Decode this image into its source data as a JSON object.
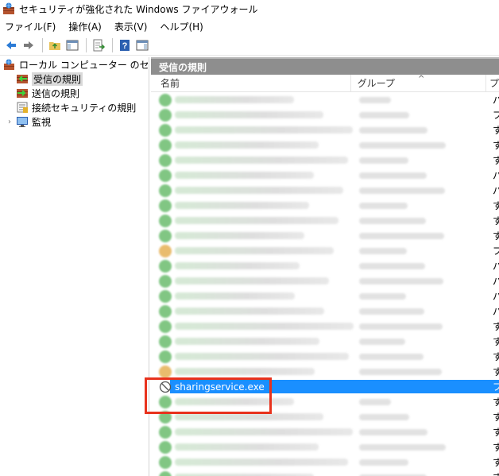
{
  "window": {
    "title": "セキュリティが強化された Windows ファイアウォール"
  },
  "menu": [
    {
      "label": "ファイル(F)"
    },
    {
      "label": "操作(A)"
    },
    {
      "label": "表示(V)"
    },
    {
      "label": "ヘルプ(H)"
    }
  ],
  "toolbar": {
    "icons": [
      "back-icon",
      "forward-icon",
      "folder-up-icon",
      "show-hide-tree-icon",
      "export-list-icon",
      "help-icon",
      "show-hide-action-pane-icon"
    ]
  },
  "tree": {
    "root": "ローカル コンピューター のセキュリティ",
    "items": [
      {
        "label": "受信の規則",
        "selected": true
      },
      {
        "label": "送信の規則"
      },
      {
        "label": "接続セキュリティの規則"
      },
      {
        "label": "監視"
      }
    ]
  },
  "pane": {
    "title": "受信の規則",
    "columns": {
      "name": "名前",
      "group": "グループ",
      "third": "プ"
    }
  },
  "rules": [
    {
      "col3": "パ",
      "status": "allow"
    },
    {
      "col3": "プ",
      "status": "allow"
    },
    {
      "col3": "す",
      "status": "allow"
    },
    {
      "col3": "す",
      "status": "allow"
    },
    {
      "col3": "す",
      "status": "allow"
    },
    {
      "col3": "パ",
      "status": "allow"
    },
    {
      "col3": "パ",
      "status": "allow"
    },
    {
      "col3": "す",
      "status": "allow"
    },
    {
      "col3": "す",
      "status": "allow"
    },
    {
      "col3": "す",
      "status": "allow"
    },
    {
      "col3": "プ",
      "status": "warn"
    },
    {
      "col3": "パ",
      "status": "allow"
    },
    {
      "col3": "パ",
      "status": "allow"
    },
    {
      "col3": "パ",
      "status": "allow"
    },
    {
      "col3": "パ",
      "status": "allow"
    },
    {
      "col3": "す",
      "status": "allow"
    },
    {
      "col3": "す",
      "status": "allow"
    },
    {
      "col3": "す",
      "status": "allow"
    },
    {
      "col3": "す",
      "status": "warn"
    }
  ],
  "selected_rule": {
    "name": "sharingservice.exe",
    "col3": "ブ",
    "status": "block"
  },
  "rules_after": [
    {
      "col3": "す",
      "status": "allow"
    },
    {
      "col3": "す",
      "status": "allow"
    },
    {
      "col3": "す",
      "status": "allow"
    },
    {
      "col3": "す",
      "status": "allow"
    },
    {
      "col3": "す",
      "status": "allow"
    },
    {
      "col3": "す",
      "status": "allow"
    }
  ],
  "colors": {
    "allow": "#4caf50",
    "warn": "#e0a030",
    "selection": "#1a8fff",
    "highlight_box": "#e8321d"
  }
}
